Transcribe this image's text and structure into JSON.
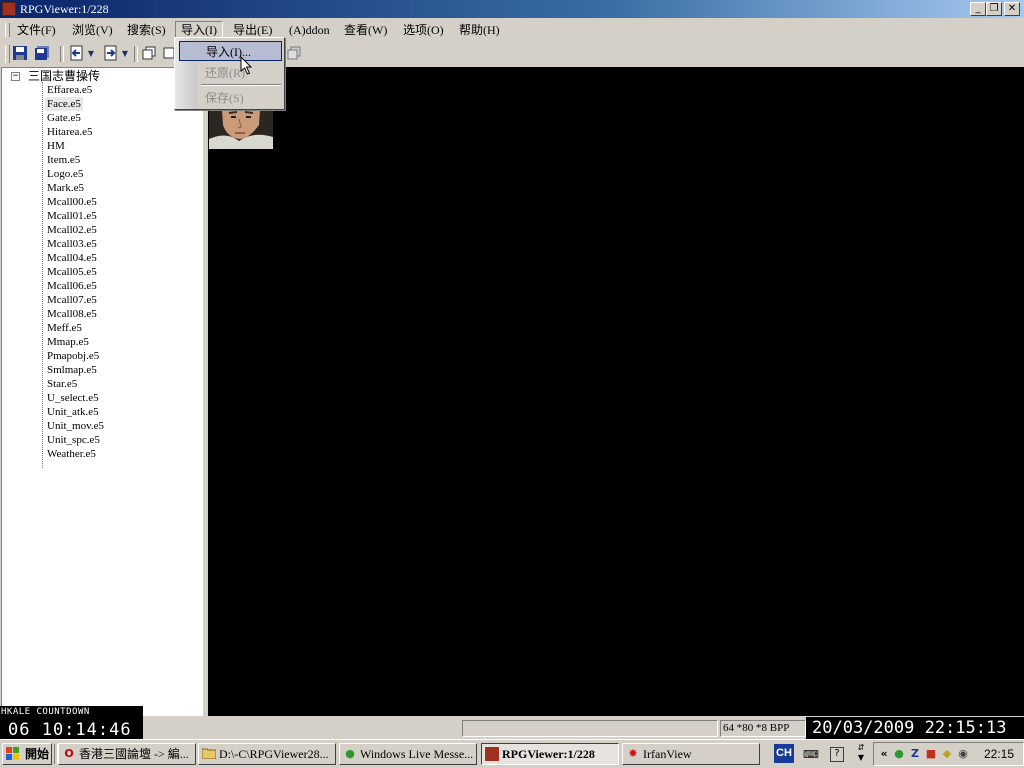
{
  "window": {
    "title": "RPGViewer:1/228"
  },
  "menu": [
    {
      "label": "文件(F)"
    },
    {
      "label": "浏览(V)"
    },
    {
      "label": "搜索(S)"
    },
    {
      "label": "导入(I)"
    },
    {
      "label": "导出(E)"
    },
    {
      "label": "(A)ddon"
    },
    {
      "label": "查看(W)"
    },
    {
      "label": "选项(O)"
    },
    {
      "label": "帮助(H)"
    }
  ],
  "import_menu": {
    "items": [
      {
        "label": "导入(I)...",
        "state": "highlighted"
      },
      {
        "label": "还原(R)",
        "state": "disabled"
      },
      {
        "label": "保存(S)",
        "state": "disabled"
      }
    ]
  },
  "toolbar": {
    "icons": [
      "save-icon",
      "save-all-icon",
      "back-icon",
      "back-dropdown-icon",
      "forward-icon",
      "forward-dropdown-icon",
      "window-icon",
      "window2-icon",
      "copy-icon"
    ]
  },
  "tree": {
    "root": "三国志曹操传",
    "items": [
      "Effarea.e5",
      "Face.e5",
      "Gate.e5",
      "Hitarea.e5",
      "HM",
      "Item.e5",
      "Logo.e5",
      "Mark.e5",
      "Mcall00.e5",
      "Mcall01.e5",
      "Mcall02.e5",
      "Mcall03.e5",
      "Mcall04.e5",
      "Mcall05.e5",
      "Mcall06.e5",
      "Mcall07.e5",
      "Mcall08.e5",
      "Meff.e5",
      "Mmap.e5",
      "Pmapobj.e5",
      "Smlmap.e5",
      "Star.e5",
      "U_select.e5",
      "Unit_atk.e5",
      "Unit_mov.e5",
      "Unit_spc.e5",
      "Weather.e5"
    ],
    "selected": "Face.e5"
  },
  "status": {
    "image_info": "64 *80 *8 BPP"
  },
  "countdown": {
    "label": "HKALE COUNTDOWN",
    "value": "06 10:14:46"
  },
  "datetime": "20/03/2009 22:15:13",
  "taskbar": {
    "start": "開始",
    "tasks": [
      {
        "label": "香港三國論壇 -> 編...",
        "icon": "opera-icon"
      },
      {
        "label": "D:\\-C\\RPGViewer28...",
        "icon": "folder-icon"
      },
      {
        "label": "Windows Live Messe...",
        "icon": "messenger-icon"
      },
      {
        "label": "RPGViewer:1/228",
        "icon": "rpgviewer-icon",
        "active": true
      },
      {
        "label": "IrfanView",
        "icon": "irfanview-icon"
      }
    ],
    "ime": "CH",
    "clock": "22:15"
  }
}
